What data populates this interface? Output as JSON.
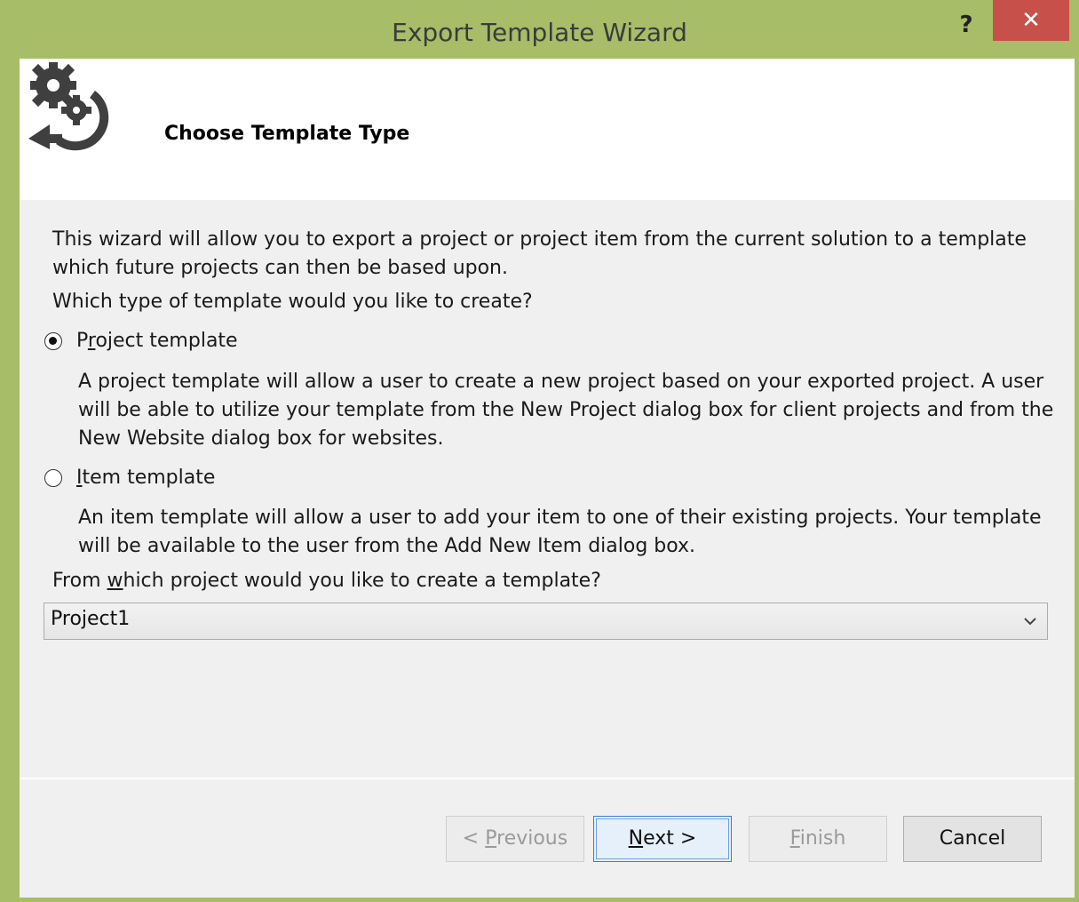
{
  "window": {
    "title": "Export Template Wizard",
    "help_label": "?",
    "close_label": "✕"
  },
  "header": {
    "title": "Choose Template Type"
  },
  "body": {
    "intro_line1": "This wizard will allow you to export a project or project item from the current solution to a template",
    "intro_line2": "which future projects can then be based upon.",
    "question": "Which type of template would you like to create?",
    "options": [
      {
        "label_pre": "P",
        "label_u": "r",
        "label_post": "oject template",
        "selected": true,
        "desc_lines": [
          "A project template will allow a user to create a new project based on your exported project. A user",
          "will be able to utilize your template from the New Project dialog box for client projects and from the",
          "New Website dialog box for websites."
        ]
      },
      {
        "label_pre": "",
        "label_u": "I",
        "label_post": "tem template",
        "selected": false,
        "desc_lines": [
          "An item template will allow a user to add your item to one of their existing projects. Your template",
          "will be available to the user from the Add New Item dialog box."
        ]
      }
    ],
    "project_question_pre": "From ",
    "project_question_u": "w",
    "project_question_post": "hich project would you like to create a template?",
    "project_selected": "Project1"
  },
  "buttons": {
    "previous_pre": "< ",
    "previous_u": "P",
    "previous_post": "revious",
    "next_u": "N",
    "next_post": "ext >",
    "finish_u": "F",
    "finish_post": "inish",
    "cancel": "Cancel"
  }
}
